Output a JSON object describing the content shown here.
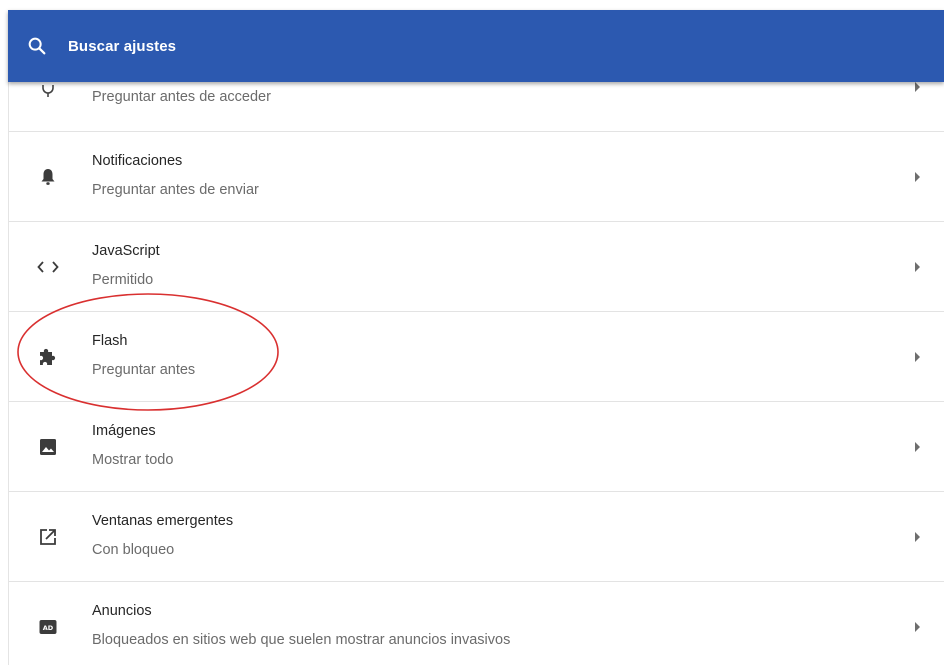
{
  "search": {
    "placeholder": "Buscar ajustes",
    "icon": "search-icon"
  },
  "colors": {
    "header": "#2c59b0",
    "highlight": "#d93030"
  },
  "settings": {
    "items": [
      {
        "title": "",
        "subtitle": "Preguntar antes de acceder",
        "icon": "microphone-icon"
      },
      {
        "title": "Notificaciones",
        "subtitle": "Preguntar antes de enviar",
        "icon": "bell-icon"
      },
      {
        "title": "JavaScript",
        "subtitle": "Permitido",
        "icon": "code-icon"
      },
      {
        "title": "Flash",
        "subtitle": "Preguntar antes",
        "icon": "puzzle-icon"
      },
      {
        "title": "Imágenes",
        "subtitle": "Mostrar todo",
        "icon": "image-icon"
      },
      {
        "title": "Ventanas emergentes",
        "subtitle": "Con bloqueo",
        "icon": "open-in-new-icon"
      },
      {
        "title": "Anuncios",
        "subtitle": "Bloqueados en sitios web que suelen mostrar anuncios invasivos",
        "icon": "ad-icon"
      }
    ]
  }
}
